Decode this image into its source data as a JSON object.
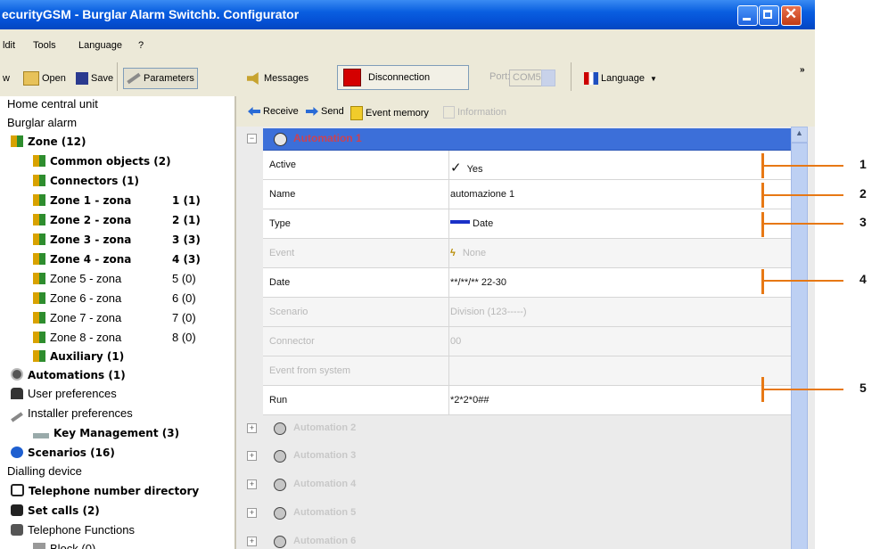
{
  "window": {
    "title": "ecurityGSM - Burglar Alarm Switchb. Configurator"
  },
  "menu": [
    "ldit",
    "Tools",
    "Language",
    "?"
  ],
  "toolbar": {
    "new": "w",
    "open": "Open",
    "save": "Save",
    "parameters": "Parameters",
    "messages": "Messages",
    "disconnection": "Disconnection",
    "port_label": "Port:",
    "port_value": "COM5",
    "language": "Language",
    "overflow": "»"
  },
  "tree": [
    {
      "label": "Home central unit",
      "count": ""
    },
    {
      "label": "Burglar alarm",
      "count": ""
    },
    {
      "label": "Zone (12)",
      "count": ""
    },
    {
      "label": "Common objects (2)",
      "count": ""
    },
    {
      "label": "Connectors (1)",
      "count": ""
    },
    {
      "label": "Zone 1 - zona",
      "count": "1 (1)"
    },
    {
      "label": "Zone 2 - zona",
      "count": "2 (1)"
    },
    {
      "label": "Zone 3 - zona",
      "count": "3 (3)"
    },
    {
      "label": "Zone 4 - zona",
      "count": "4 (3)"
    },
    {
      "label": "Zone 5 - zona",
      "count": "5 (0)"
    },
    {
      "label": "Zone 6 - zona",
      "count": "6 (0)"
    },
    {
      "label": "Zone 7 - zona",
      "count": "7 (0)"
    },
    {
      "label": "Zone 8 - zona",
      "count": "8 (0)"
    },
    {
      "label": "Auxiliary (1)",
      "count": ""
    },
    {
      "label": "Automations (1)",
      "count": ""
    },
    {
      "label": "User preferences",
      "count": ""
    },
    {
      "label": "Installer preferences",
      "count": ""
    },
    {
      "label": "Key Management (3)",
      "count": ""
    },
    {
      "label": "Scenarios (16)",
      "count": ""
    },
    {
      "label": "Dialling device",
      "count": ""
    },
    {
      "label": "Telephone number directory",
      "count": ""
    },
    {
      "label": "Set calls (2)",
      "count": ""
    },
    {
      "label": "Telephone Functions",
      "count": ""
    },
    {
      "label": "Block (0)",
      "count": ""
    }
  ],
  "right_toolbar": {
    "receive": "Receive",
    "send": "Send",
    "event_memory": "Event memory",
    "information": "Information"
  },
  "group": {
    "name": "Automation 1",
    "expander": "−"
  },
  "properties": [
    {
      "key": "Active",
      "value": "Yes",
      "icon": "check-icon"
    },
    {
      "key": "Name",
      "value": "automazione 1"
    },
    {
      "key": "Type",
      "value": "Date",
      "icon": "blue-bar-icon"
    },
    {
      "key": "Event",
      "value": "None",
      "icon": "lightning-icon"
    },
    {
      "key": "Date",
      "value": "**/**/** 22-30"
    },
    {
      "key": "Scenario",
      "value": "Division (123-----)"
    },
    {
      "key": "Connector",
      "value": "00"
    },
    {
      "key": "Event from system",
      "value": ""
    },
    {
      "key": "Run",
      "value": "*2*2*0##"
    }
  ],
  "collapsed_groups": [
    "Automation 2",
    "Automation 3",
    "Automation 4",
    "Automation 5",
    "Automation 6"
  ],
  "callouts": [
    "1",
    "2",
    "3",
    "4",
    "5"
  ],
  "colors": {
    "accent": "#3c6fd9",
    "callout": "#e77814",
    "title_bar": "#0551d6"
  }
}
